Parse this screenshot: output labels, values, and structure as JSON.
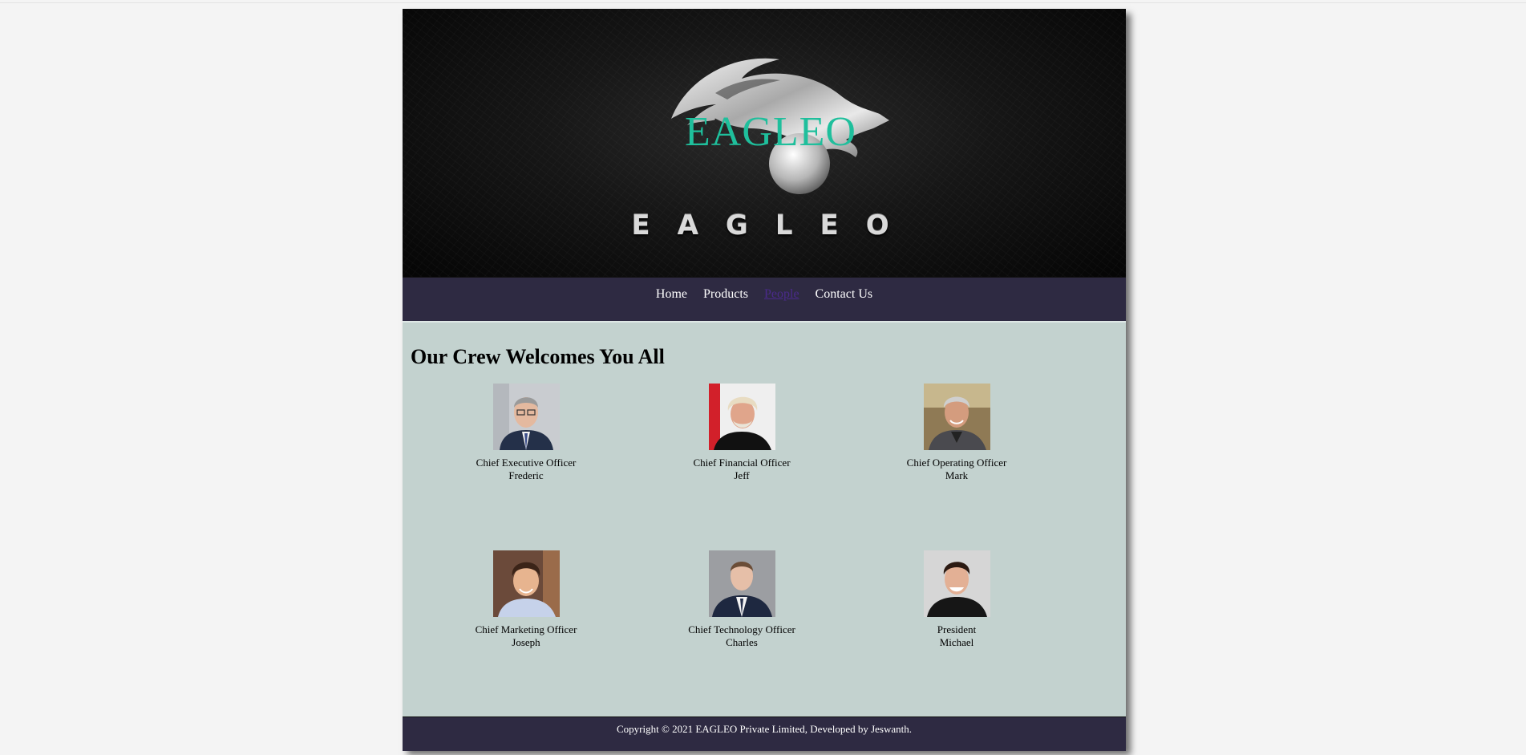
{
  "banner": {
    "logo_text": "EAGLEO",
    "brand_word": "EAGLEO"
  },
  "nav": {
    "items": [
      {
        "label": "Home"
      },
      {
        "label": "Products"
      },
      {
        "label": "People",
        "active": true
      },
      {
        "label": "Contact Us"
      }
    ]
  },
  "main": {
    "heading": "Our Crew Welcomes You All",
    "members": [
      {
        "role": "Chief Executive Officer",
        "name": "Frederic"
      },
      {
        "role": "Chief Financial Officer",
        "name": "Jeff"
      },
      {
        "role": "Chief Operating Officer",
        "name": "Mark"
      },
      {
        "role": "Chief Marketing Officer",
        "name": "Joseph"
      },
      {
        "role": "Chief Technology Officer",
        "name": "Charles"
      },
      {
        "role": "President",
        "name": "Michael"
      }
    ]
  },
  "footer": {
    "copyright": "Copyright © 2021 EAGLEO Private Limited, Developed by Jeswanth."
  },
  "colors": {
    "page_bg": "#f4f4f4",
    "nav_bg": "#2e2a42",
    "content_bg": "#c3d2cf",
    "logo_accent": "#1fbf9c",
    "active_link": "#4a2a8a"
  }
}
